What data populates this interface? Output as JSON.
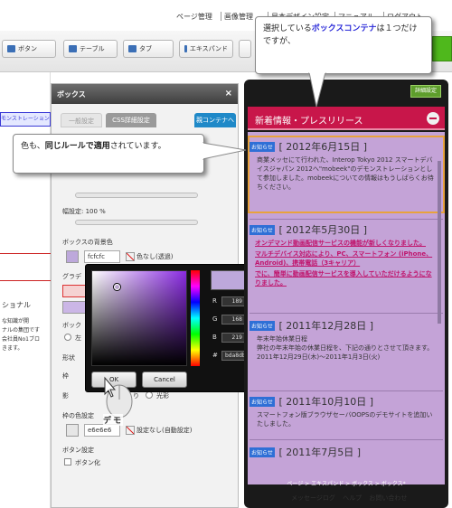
{
  "topmenu": {
    "items": [
      "ページ管理",
      "画像管理",
      "見本デザイン設定",
      "マニュアル",
      "ログアウト"
    ]
  },
  "toolbar": {
    "buttons": [
      "ボタン",
      "テーブル",
      "タブ",
      "エキスパンド",
      ""
    ]
  },
  "leftstrip": {
    "blue_text": "モンストレーション",
    "label1": "ショナル",
    "line1": "な知識が開",
    "line2": "ナルの集団です",
    "line3": "会社員No1ブロ",
    "line4": "きます。"
  },
  "panel": {
    "title": "ボックス",
    "close": "×",
    "tabs": [
      "一般設定",
      "CSS詳細設定",
      "親コンテナへ"
    ],
    "width_label": "幅設定: 100 %",
    "bg_color_label": "ボックスの背景色",
    "bg_hex": "fcfcfc",
    "bg_nofill": "色なし(透過)",
    "gradient_label": "グラデ",
    "box_label": "ボック",
    "left_label": "左",
    "shape_label": "形状",
    "border_label": "枠",
    "shadow_label": "影",
    "shadow_options": [
      "り",
      "光彩"
    ],
    "border_color_label": "枠の色設定",
    "border_hex": "e6e6e6",
    "border_nofill": "設定なし(自動設定)",
    "button_settings_label": "ボタン設定",
    "button_check_label": "ボタン化"
  },
  "tooltips": {
    "top_prefix": "選択している",
    "top_highlight": "ボックスコンテナ",
    "top_suffix": "は１つだけですが、",
    "left_prefix": "色も、",
    "left_bold": "同じルールで適用",
    "left_suffix": "されています。"
  },
  "picker": {
    "fields": [
      {
        "label": "R",
        "value": "189"
      },
      {
        "label": "H",
        "value": "264"
      },
      {
        "label": "G",
        "value": "168"
      },
      {
        "label": "S",
        "value": "23"
      },
      {
        "label": "B",
        "value": "219"
      },
      {
        "label": "B",
        "value": "86"
      }
    ],
    "hash": "#",
    "hex_value": "bda8db",
    "ok_label": "OK",
    "cancel_label": "Cancel",
    "new_color": "#bda8db"
  },
  "demo_label": "デモ",
  "preview": {
    "detail_button": "詳細設定",
    "header_title": "新着情報・プレスリリース",
    "entries": [
      {
        "badge": "お知らせ",
        "date": "[ 2012年6月15日 ]",
        "text": "商業メッセにて行われた、Interop Tokyo 2012 スマートデバイスジャパン 2012へ\"mobeek\"のデモンストレーションとして参加しました。mobeekについての情報はもうしばらくお待ちください。"
      },
      {
        "badge": "お知らせ",
        "date": "[ 2012年5月30日 ]",
        "link1": "オンデマンド動画配信サービスの機能が新しくなりました。",
        "link2": "マルチデバイス対応により、PC、スマートフォン (iPhone、Android)、携帯電話（3キャリア）",
        "link3": "でに、簡単に動画配信サービスを導入していただけるようになりました。"
      },
      {
        "badge": "お知らせ",
        "date": "[ 2011年12月28日 ]",
        "text": "年末年始休業日程\n弊社の年末年始の休業日程を、下記の通りとさせて頂きます。\n2011年12月29日(木)～2011年1月3日(火)"
      },
      {
        "badge": "お知らせ",
        "date": "[ 2011年10月10日 ]",
        "text": "スマートフォン版ブラウザセーバOOPSのデモサイトを追加いたしました。"
      },
      {
        "badge": "お知らせ",
        "date": "[ 2011年7月5日 ]",
        "text": ""
      }
    ],
    "breadcrumb": "ページ > エキスパンド > ボックス > ボックス*"
  },
  "footer": {
    "links": [
      "メッセージログ",
      "ヘルプ",
      "お問い合わせ"
    ]
  },
  "colors": {
    "header": "#c8164a",
    "body": "#c4a3d7",
    "selected_border": "#e8a23c",
    "accent_green": "#4fb81c"
  }
}
